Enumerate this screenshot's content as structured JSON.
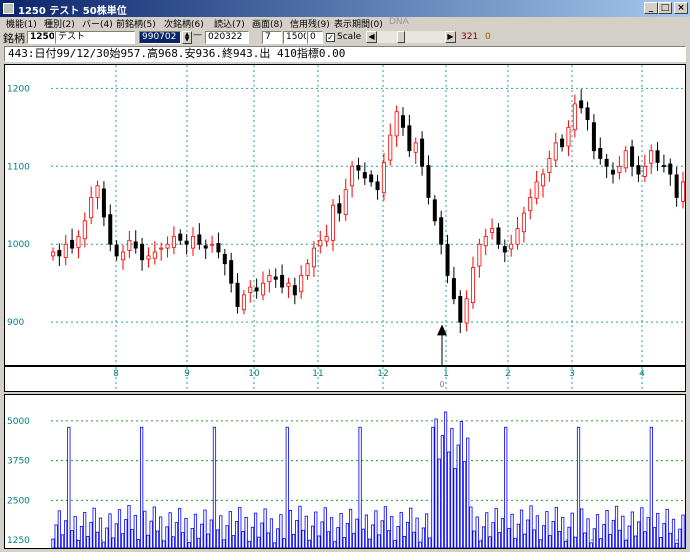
{
  "window": {
    "title": "1250 テスト 50株単位"
  },
  "menu": [
    "機能(1)",
    "種別(2)",
    "バー(4)",
    "前銘柄(5)",
    "次銘柄(6)",
    "読込(7)",
    "画面(8)",
    "信用残(9)",
    "表示期間(0)",
    "DNA"
  ],
  "toolbar": {
    "code_label": "銘柄",
    "code_value": "1250",
    "name_value": "テスト",
    "start_date": "990702",
    "dash": "—",
    "end_date": "020322",
    "field_a": "7",
    "field_b": "1500",
    "field_c": "0",
    "scale_label": "Scale",
    "count": "321",
    "extra": "0"
  },
  "info": "443:日付99/12/30始957.高968.安936.終943.出 410指標0.00",
  "colors": {
    "up": "#ff0000",
    "down": "#000000",
    "grid": "#2f9f9f",
    "volume": "#0000ff",
    "volgrid": "#20a020",
    "axis": "#008080"
  },
  "chart_data": [
    {
      "type": "candlestick",
      "price_axis": {
        "ticks": [
          900,
          1000,
          1100,
          1200
        ],
        "ylim": [
          845,
          1230
        ]
      },
      "time_axis": {
        "ticks": [
          "8",
          "9",
          "10",
          "11",
          "12",
          "1",
          "2",
          "3",
          "4"
        ]
      },
      "marker": {
        "label": "0"
      },
      "close_series": [
        990,
        985,
        1000,
        995,
        1010,
        1030,
        1060,
        1075,
        1035,
        1000,
        985,
        990,
        1005,
        995,
        980,
        985,
        990,
        995,
        1000,
        1010,
        1005,
        1000,
        1010,
        1000,
        995,
        1000,
        990,
        975,
        950,
        920,
        935,
        945,
        940,
        950,
        960,
        955,
        945,
        950,
        935,
        960,
        975,
        995,
        1005,
        1010,
        1050,
        1040,
        1070,
        1100,
        1095,
        1085,
        1080,
        1070,
        1105,
        1140,
        1170,
        1150,
        1120,
        1130,
        1100,
        1060,
        1030,
        1000,
        960,
        930,
        900,
        930,
        970,
        1000,
        1010,
        1020,
        1000,
        990,
        1000,
        1020,
        1040,
        1060,
        1080,
        1090,
        1110,
        1130,
        1125,
        1150,
        1180,
        1175,
        1160,
        1120,
        1110,
        1100,
        1090,
        1100,
        1120,
        1100,
        1090,
        1100,
        1120,
        1105,
        1100,
        1090,
        1060,
        1080
      ]
    },
    {
      "type": "bar",
      "name": "volume",
      "ylim": [
        1000,
        5500
      ],
      "yticks": [
        1250,
        2500,
        3750,
        5000
      ]
    }
  ]
}
